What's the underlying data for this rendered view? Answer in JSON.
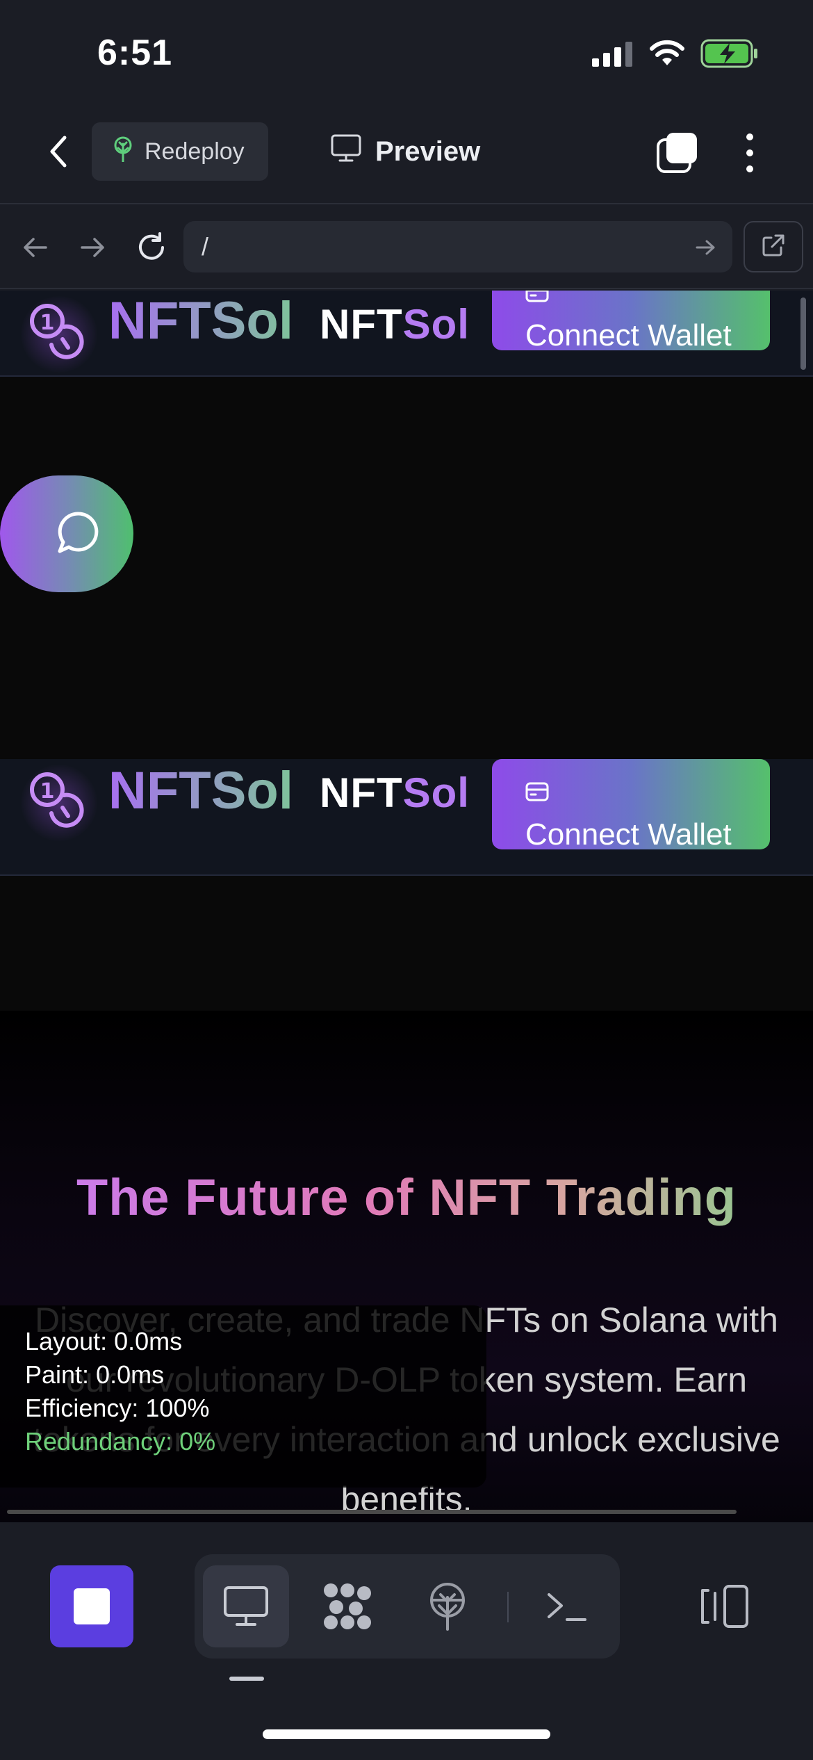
{
  "status_bar": {
    "time": "6:51"
  },
  "header": {
    "redeploy_label": "Redeploy",
    "preview_label": "Preview",
    "icons": [
      "back-chevron-icon",
      "deploy-tree-icon",
      "monitor-icon",
      "tabs-icon",
      "more-vertical-icon"
    ]
  },
  "browser": {
    "url": "/",
    "icons": [
      "back-arrow-icon",
      "forward-arrow-icon",
      "reload-icon",
      "go-arrow-icon",
      "open-external-icon"
    ]
  },
  "site": {
    "brand": "NFTSol",
    "brand_alt_1": "NFT",
    "brand_alt_2": "Sol",
    "connect_wallet": "Connect Wallet",
    "hero_title": "The Future of NFT Trading",
    "hero_description": "Discover, create, and trade NFTs on Solana with our revolutionary D-OLP token system. Earn tokens for every interaction and unlock exclusive benefits.",
    "colors": {
      "purple": "#8e4be9",
      "green": "#55c06c",
      "nav_bg": "#11151f"
    }
  },
  "perf": {
    "layout": "Layout: 0.0ms",
    "paint": "Paint: 0.0ms",
    "efficiency": "Efficiency: 100%",
    "redundancy": "Redundancy: 0%"
  },
  "toolbar": {
    "icons": [
      "stop-icon",
      "desktop-icon",
      "components-icon",
      "deploy-icon",
      "terminal-icon",
      "panel-toggle-icon"
    ],
    "accent": "#5b3ee0"
  }
}
